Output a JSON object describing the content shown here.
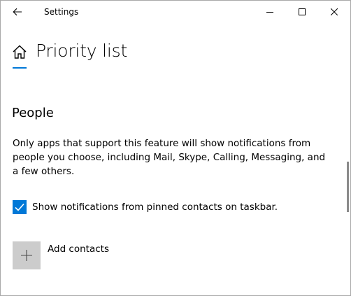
{
  "window": {
    "title": "Settings",
    "back_icon": "arrow-left-icon",
    "minimize_icon": "minimize-icon",
    "maximize_icon": "maximize-icon",
    "close_icon": "close-icon"
  },
  "header": {
    "home_icon": "home-icon",
    "title": "Priority list",
    "accent_color": "#0078d7"
  },
  "people": {
    "heading": "People",
    "description": "Only apps that support this feature will show notifications from people you choose, including Mail, Skype, Calling, Messaging, and a few others.",
    "checkbox": {
      "label": "Show notifications from pinned contacts on taskbar.",
      "checked": true,
      "icon": "checkmark-icon"
    },
    "add_contacts": {
      "label": "Add contacts",
      "icon": "plus-icon",
      "tile_color": "#cccccc"
    }
  }
}
